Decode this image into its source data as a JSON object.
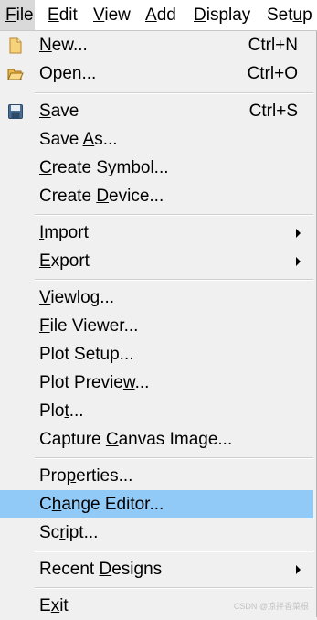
{
  "menubar": {
    "items": [
      {
        "pre": "",
        "u": "F",
        "post": "ile"
      },
      {
        "pre": "",
        "u": "E",
        "post": "dit"
      },
      {
        "pre": "",
        "u": "V",
        "post": "iew"
      },
      {
        "pre": "",
        "u": "A",
        "post": "dd"
      },
      {
        "pre": "",
        "u": "D",
        "post": "isplay"
      },
      {
        "pre": "Set",
        "u": "u",
        "post": "p"
      }
    ]
  },
  "menu": {
    "new": {
      "pre": "",
      "u": "N",
      "post": "ew...",
      "shortcut": "Ctrl+N",
      "icon": "new-file-icon"
    },
    "open": {
      "pre": "",
      "u": "O",
      "post": "pen...",
      "shortcut": "Ctrl+O",
      "icon": "open-folder-icon"
    },
    "save": {
      "pre": "",
      "u": "S",
      "post": "ave",
      "shortcut": "Ctrl+S",
      "icon": "floppy-disk-icon"
    },
    "save_as": {
      "pre": "Save ",
      "u": "A",
      "post": "s..."
    },
    "create_symbol": {
      "pre": "",
      "u": "C",
      "post": "reate Symbol..."
    },
    "create_device": {
      "pre": "Create ",
      "u": "D",
      "post": "evice..."
    },
    "import": {
      "pre": "",
      "u": "I",
      "post": "mport"
    },
    "export": {
      "pre": "",
      "u": "E",
      "post": "xport"
    },
    "viewlog": {
      "pre": "",
      "u": "V",
      "post": "iewlog..."
    },
    "file_viewer": {
      "pre": "",
      "u": "F",
      "post": "ile Viewer..."
    },
    "plot_setup": {
      "pre": "Plot Setup...",
      "u": "",
      "post": ""
    },
    "plot_preview": {
      "pre": "Plot Previe",
      "u": "w",
      "post": "..."
    },
    "plot": {
      "pre": "Plo",
      "u": "t",
      "post": "..."
    },
    "capture": {
      "pre": "Capture ",
      "u": "C",
      "post": "anvas Image..."
    },
    "properties": {
      "pre": "Pro",
      "u": "p",
      "post": "erties..."
    },
    "change_editor": {
      "pre": "C",
      "u": "h",
      "post": "ange Editor..."
    },
    "script": {
      "pre": "Sc",
      "u": "r",
      "post": "ipt..."
    },
    "recent": {
      "pre": "Recent ",
      "u": "D",
      "post": "esigns"
    },
    "exit": {
      "pre": "E",
      "u": "x",
      "post": "it"
    }
  },
  "watermark": "CSDN @凉拌香菜根",
  "colors": {
    "highlight": "#91c9f7",
    "menu_bg": "#f0f0f0",
    "menubar_bg": "#ffffff"
  }
}
